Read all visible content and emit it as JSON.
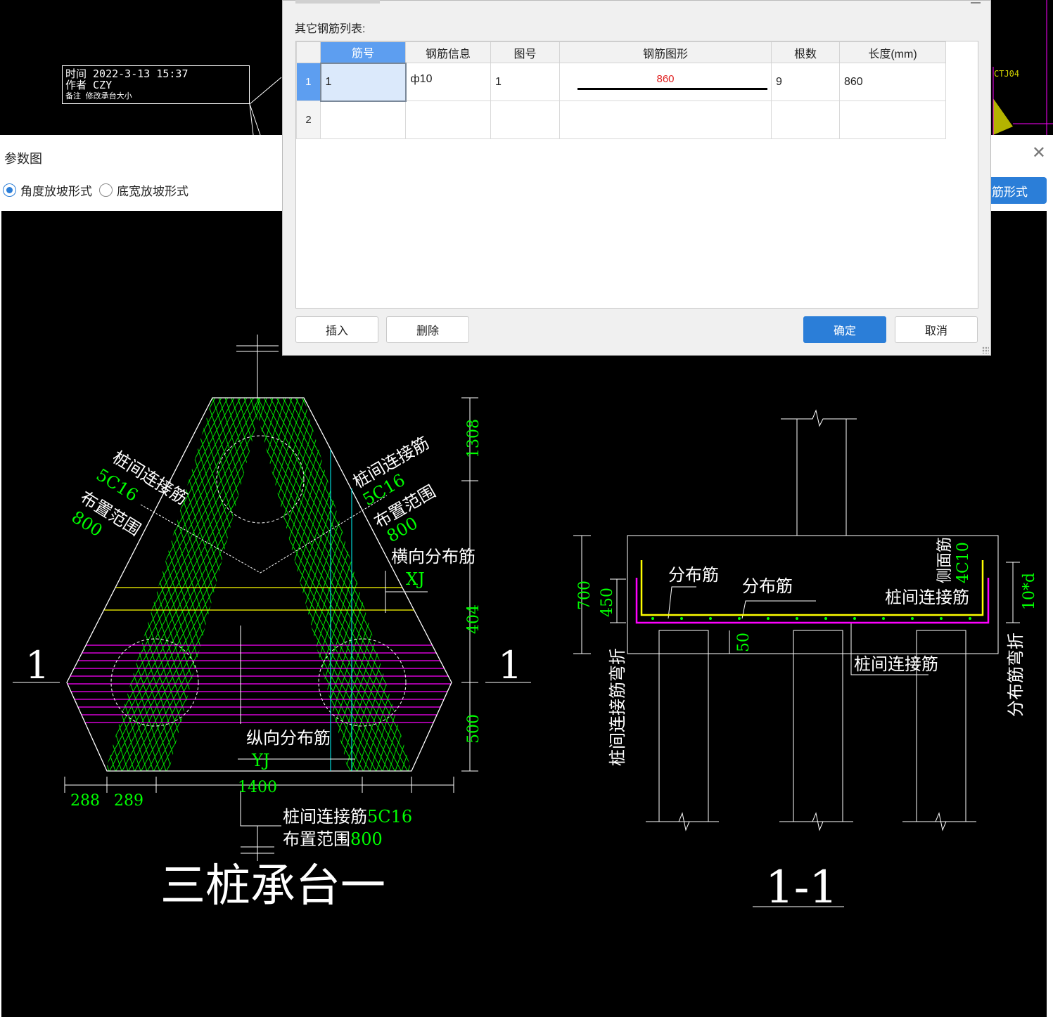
{
  "background_cad": {
    "stamp_line1": "时间 2022-3-13  15:37",
    "stamp_line2": "作者 CZY",
    "stamp_line3": "备注 修改承台大小",
    "tag": "CTJ04"
  },
  "param_window": {
    "title": "参数图",
    "close_icon": "close-icon",
    "radio_options": [
      {
        "label": "角度放坡形式",
        "selected": true
      },
      {
        "label": "底宽放坡形式",
        "selected": false
      }
    ],
    "rebar_form_button": "筋形式"
  },
  "rebar_dialog": {
    "list_label": "其它钢筋列表:",
    "columns": [
      "筋号",
      "钢筋信息",
      "图号",
      "钢筋图形",
      "根数",
      "长度(mm)"
    ],
    "rows": [
      {
        "row": "1",
        "bar_no": "1",
        "info": "ф10",
        "fig_no": "1",
        "shape_value": "860",
        "count": "9",
        "length": "860"
      },
      {
        "row": "2",
        "bar_no": "",
        "info": "",
        "fig_no": "",
        "shape_value": "",
        "count": "",
        "length": ""
      }
    ],
    "buttons": {
      "insert": "插入",
      "delete": "删除",
      "ok": "确定",
      "cancel": "取消"
    }
  },
  "drawing": {
    "plan": {
      "title": "三桩承台一",
      "section_mark_left": "1",
      "section_mark_right": "1",
      "label_left_a": "桩间连接筋",
      "label_left_b": "5C16",
      "label_left_c": "布置范围",
      "label_left_d": "800",
      "label_right_a": "桩间连接筋",
      "label_right_b": "5C16",
      "label_right_c": "布置范围",
      "label_right_d": "800",
      "label_transverse": "横向分布筋",
      "label_xj": "XJ",
      "label_longitudinal": "纵向分布筋",
      "label_yj": "YJ",
      "bottom_label_a": "桩间连接筋",
      "bottom_label_a_val": "5C16",
      "bottom_label_b": "布置范围",
      "bottom_label_b_val": "800",
      "dim_1308": "1308",
      "dim_404": "404",
      "dim_500": "500",
      "dim_288": "288",
      "dim_289": "289",
      "dim_1400": "1400"
    },
    "section": {
      "title": "1-1",
      "label_dist1": "分布筋",
      "label_dist2": "分布筋",
      "label_side": "侧面筋",
      "label_side_val": "4C10",
      "label_link": "桩间连接筋",
      "label_link_bottom": "桩间连接筋",
      "label_left_vert": "桩间连接筋弯折",
      "label_right_vert": "分布筋弯折",
      "dim_700": "700",
      "dim_450": "450",
      "dim_50": "50",
      "dim_10d": "10*d"
    }
  },
  "colors": {
    "accent": "#2b7ed8",
    "cad_green": "#00ff00",
    "cad_magenta": "#ff00ff",
    "cad_yellow": "#ffff00",
    "cad_cyan": "#00ffff",
    "shape_red": "#e02020"
  }
}
